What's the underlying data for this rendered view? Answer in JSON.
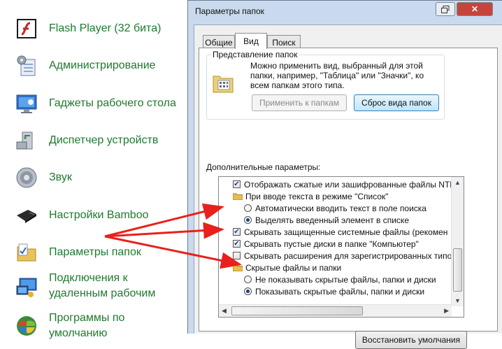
{
  "control_panel": {
    "items": [
      {
        "label": "Flash Player (32 бита)",
        "icon": "flash-icon"
      },
      {
        "label": "Администрирование",
        "icon": "admin-tools-icon"
      },
      {
        "label": "Гаджеты рабочего стола",
        "icon": "gadgets-icon"
      },
      {
        "label": "Диспетчер устройств",
        "icon": "device-manager-icon"
      },
      {
        "label": "Звук",
        "icon": "speaker-icon"
      },
      {
        "label": "Настройки Bamboo",
        "icon": "tablet-icon"
      },
      {
        "label": "Параметры папок",
        "icon": "folder-options-icon"
      },
      {
        "label": "Подключения к",
        "label2": "удаленным рабочим",
        "icon": "remote-desktop-icon"
      },
      {
        "label": "Программы по",
        "label2": "умолчанию",
        "icon": "default-programs-icon"
      }
    ],
    "link_color": "#1e7a2d"
  },
  "dialog": {
    "title": "Параметры папок",
    "tabs": [
      {
        "label": "Общие",
        "active": false
      },
      {
        "label": "Вид",
        "active": true
      },
      {
        "label": "Поиск",
        "active": false
      }
    ],
    "folder_views": {
      "title": "Представление папок",
      "description": "Можно применить вид, выбранный для этой папки, например, \"Таблица\" или \"Значки\", ко всем папкам этого типа.",
      "apply_button": "Применить к папкам",
      "reset_button": "Сброс вида папок"
    },
    "advanced_label": "Дополнительные параметры:",
    "settings": [
      {
        "type": "checkbox",
        "checked": true,
        "indent": 1,
        "label": "Отображать сжатые или зашифрованные файлы NTF"
      },
      {
        "type": "folder",
        "indent": 1,
        "label": "При вводе текста в режиме \"Список\""
      },
      {
        "type": "radio",
        "checked": false,
        "indent": 2,
        "label": "Автоматически вводить текст в поле поиска"
      },
      {
        "type": "radio",
        "checked": true,
        "indent": 2,
        "label": "Выделять введенный элемент в списке"
      },
      {
        "type": "checkbox",
        "checked": true,
        "indent": 1,
        "label": "Скрывать защищенные системные файлы (рекомен"
      },
      {
        "type": "checkbox",
        "checked": true,
        "indent": 1,
        "label": "Скрывать пустые диски в папке \"Компьютер\""
      },
      {
        "type": "checkbox",
        "checked": false,
        "indent": 1,
        "label": "Скрывать расширения для зарегистрированных типо"
      },
      {
        "type": "folder",
        "indent": 1,
        "label": "Скрытые файлы и папки"
      },
      {
        "type": "radio",
        "checked": false,
        "indent": 2,
        "label": "Не показывать скрытые файлы, папки и диски"
      },
      {
        "type": "radio",
        "checked": true,
        "indent": 2,
        "label": "Показывать скрытые файлы, папки и диски"
      }
    ],
    "restore_button": "Восстановить умолчания",
    "arrow_color": "#e8211c"
  }
}
